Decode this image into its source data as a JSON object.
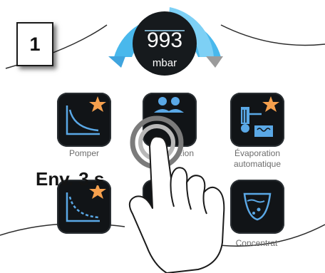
{
  "step_number": "1",
  "gauge": {
    "value": "993",
    "unit": "mbar",
    "accent": "#4fc3f7"
  },
  "tiles": [
    {
      "label": "Pomper",
      "icon": "pump-down-curve-star-icon"
    },
    {
      "label": "Navigation",
      "visible_label": "...ion",
      "icon": "people-icon"
    },
    {
      "label": "Évaporation\nautomatique",
      "icon": "auto-evaporation-star-icon"
    },
    {
      "label": "",
      "icon": "pump-down-curve-star-icon"
    },
    {
      "label": "",
      "icon": "hidden-icon"
    },
    {
      "label": "Concentrat",
      "icon": "concentration-flask-icon"
    }
  ],
  "gesture_label": "Env. 3 s",
  "colors": {
    "star": "#f6a04d",
    "icon_blue": "#5aa8e6",
    "tile_bg": "#111417"
  }
}
